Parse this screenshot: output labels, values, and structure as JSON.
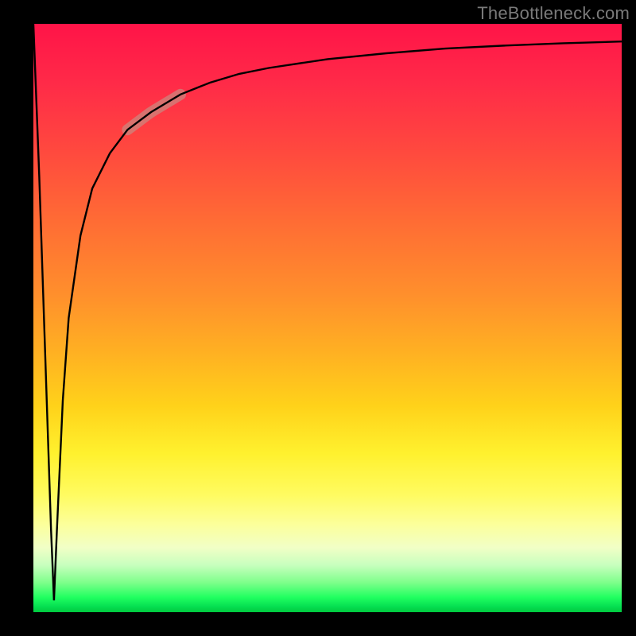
{
  "watermark": "TheBottleneck.com",
  "colors": {
    "gradient_top": "#ff1448",
    "gradient_mid1": "#ff8f2c",
    "gradient_mid2": "#fff12e",
    "gradient_bottom": "#00c93e",
    "curve": "#000000",
    "highlight": "#c88b82",
    "frame": "#000000"
  },
  "chart_data": {
    "type": "line",
    "title": "",
    "xlabel": "",
    "ylabel": "",
    "xlim": [
      0,
      100
    ],
    "ylim": [
      0,
      100
    ],
    "grid": false,
    "legend": null,
    "annotations": [
      {
        "text": "TheBottleneck.com",
        "role": "watermark",
        "pos": "top-right"
      }
    ],
    "series": [
      {
        "name": "bottleneck-curve",
        "note": "Curve starts at y≈100 at x=0, plunges to y≈0 near x≈3.5, then rises asymptotically toward y≈97 as x→100. Values estimated from pixel positions (no axis ticks visible).",
        "x": [
          0,
          1,
          2,
          3,
          3.5,
          4,
          5,
          6,
          8,
          10,
          13,
          16,
          20,
          25,
          30,
          35,
          40,
          50,
          60,
          70,
          80,
          90,
          100
        ],
        "y": [
          100,
          74,
          44,
          14,
          2,
          14,
          36,
          50,
          64,
          72,
          78,
          82,
          85,
          88,
          90,
          91.5,
          92.5,
          94,
          95,
          95.8,
          96.3,
          96.7,
          97
        ]
      }
    ],
    "highlight_segment": {
      "x_range": [
        16,
        25
      ],
      "note": "thick translucent salmon stroke overlaid on curve in this x-range"
    },
    "background_gradient": {
      "direction": "vertical",
      "stops": [
        {
          "pos": 0.0,
          "color": "#ff1448"
        },
        {
          "pos": 0.46,
          "color": "#ff8f2c"
        },
        {
          "pos": 0.73,
          "color": "#fff12e"
        },
        {
          "pos": 0.95,
          "color": "#7dff8a"
        },
        {
          "pos": 1.0,
          "color": "#00c93e"
        }
      ]
    }
  }
}
